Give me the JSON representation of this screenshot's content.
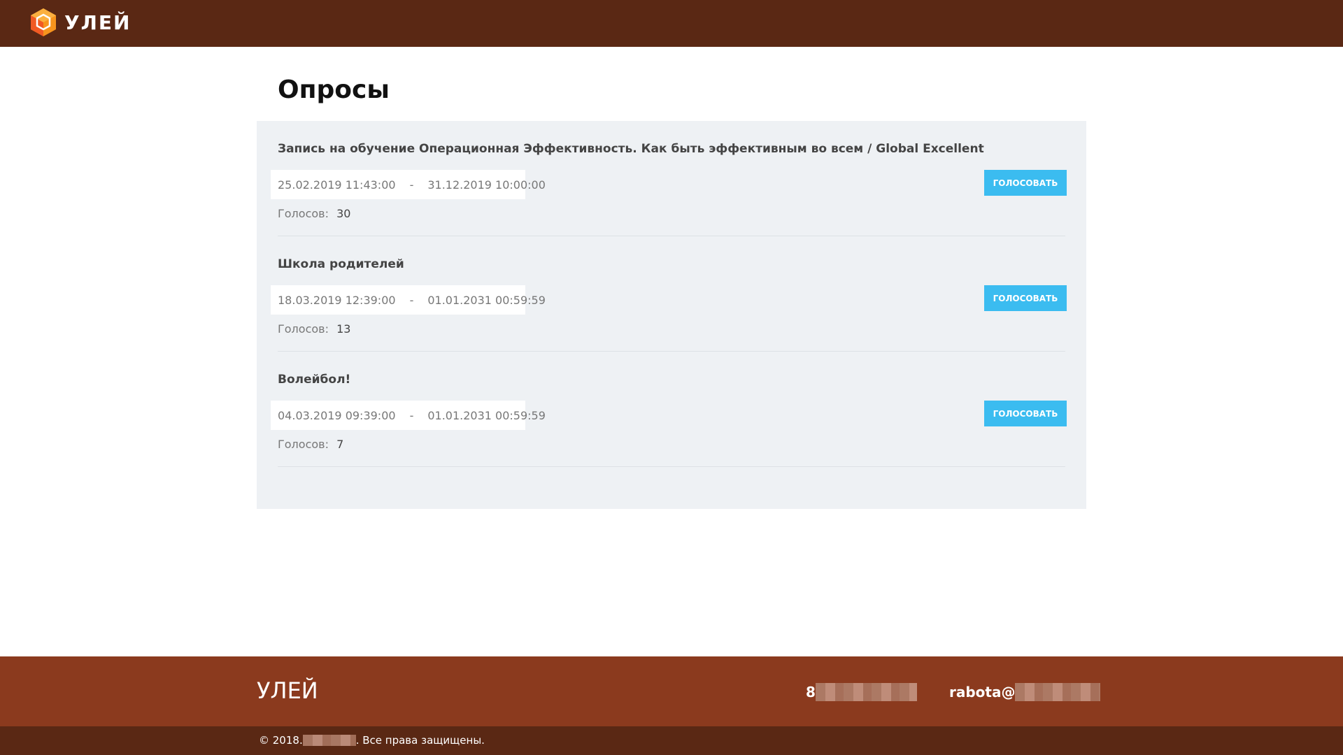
{
  "header": {
    "brand": "УЛЕЙ",
    "logo_icon": "hexagon-cube-logo",
    "logo_colors": [
      "#f7941d",
      "#fbb040",
      "#f15a24"
    ]
  },
  "page": {
    "title": "Опросы"
  },
  "polls": [
    {
      "title": "Запись на обучение Операционная Эффективность. Как быть эффективным во всем / Global Excellent",
      "start": "25.02.2019 11:43:00",
      "separator": "-",
      "end": "31.12.2019 10:00:00",
      "votes_label": "Голосов:",
      "votes": "30",
      "button": "Голосовать"
    },
    {
      "title": "Школа родителей",
      "start": "18.03.2019 12:39:00",
      "separator": "-",
      "end": "01.01.2031 00:59:59",
      "votes_label": "Голосов:",
      "votes": "13",
      "button": "Голосовать"
    },
    {
      "title": "Волейбол!",
      "start": "04.03.2019 09:39:00",
      "separator": "-",
      "end": "01.01.2031 00:59:59",
      "votes_label": "Голосов:",
      "votes": "7",
      "button": "Голосовать"
    }
  ],
  "footer": {
    "brand": "УЛЕЙ",
    "phone_prefix": "8",
    "email_prefix": "rabota@",
    "copyright_prefix": "© 2018.",
    "copyright_suffix": ". Все права защищены."
  },
  "colors": {
    "header_bg": "#5a2814",
    "footer_bg": "#8b3a1e",
    "button_bg": "#3bbcf0",
    "panel_bg": "#eef1f4"
  }
}
